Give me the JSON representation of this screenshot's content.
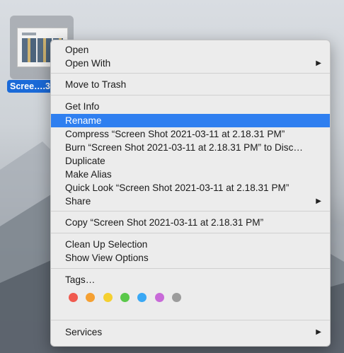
{
  "file": {
    "label": "Scree….3"
  },
  "menu": {
    "open": "Open",
    "open_with": "Open With",
    "move_to_trash": "Move to Trash",
    "get_info": "Get Info",
    "rename": "Rename",
    "compress": "Compress “Screen Shot 2021-03-11 at 2.18.31 PM”",
    "burn": "Burn “Screen Shot 2021-03-11 at 2.18.31 PM” to Disc…",
    "duplicate": "Duplicate",
    "make_alias": "Make Alias",
    "quick_look": "Quick Look “Screen Shot 2021-03-11 at 2.18.31 PM”",
    "share": "Share",
    "copy": "Copy “Screen Shot 2021-03-11 at 2.18.31 PM”",
    "clean_up": "Clean Up Selection",
    "show_view_options": "Show View Options",
    "tags": "Tags…",
    "services": "Services",
    "submenu_arrow": "▶"
  },
  "tag_colors": [
    {
      "name": "red",
      "color": "#f05a4f"
    },
    {
      "name": "orange",
      "color": "#f5a032"
    },
    {
      "name": "yellow",
      "color": "#f5d030"
    },
    {
      "name": "green",
      "color": "#5ac84a"
    },
    {
      "name": "blue",
      "color": "#3aa8f5"
    },
    {
      "name": "purple",
      "color": "#c86ad8"
    },
    {
      "name": "gray",
      "color": "#9c9c9c"
    }
  ],
  "colors": {
    "highlight": "#2f7ff0",
    "selection_label": "#1b6ad8"
  }
}
